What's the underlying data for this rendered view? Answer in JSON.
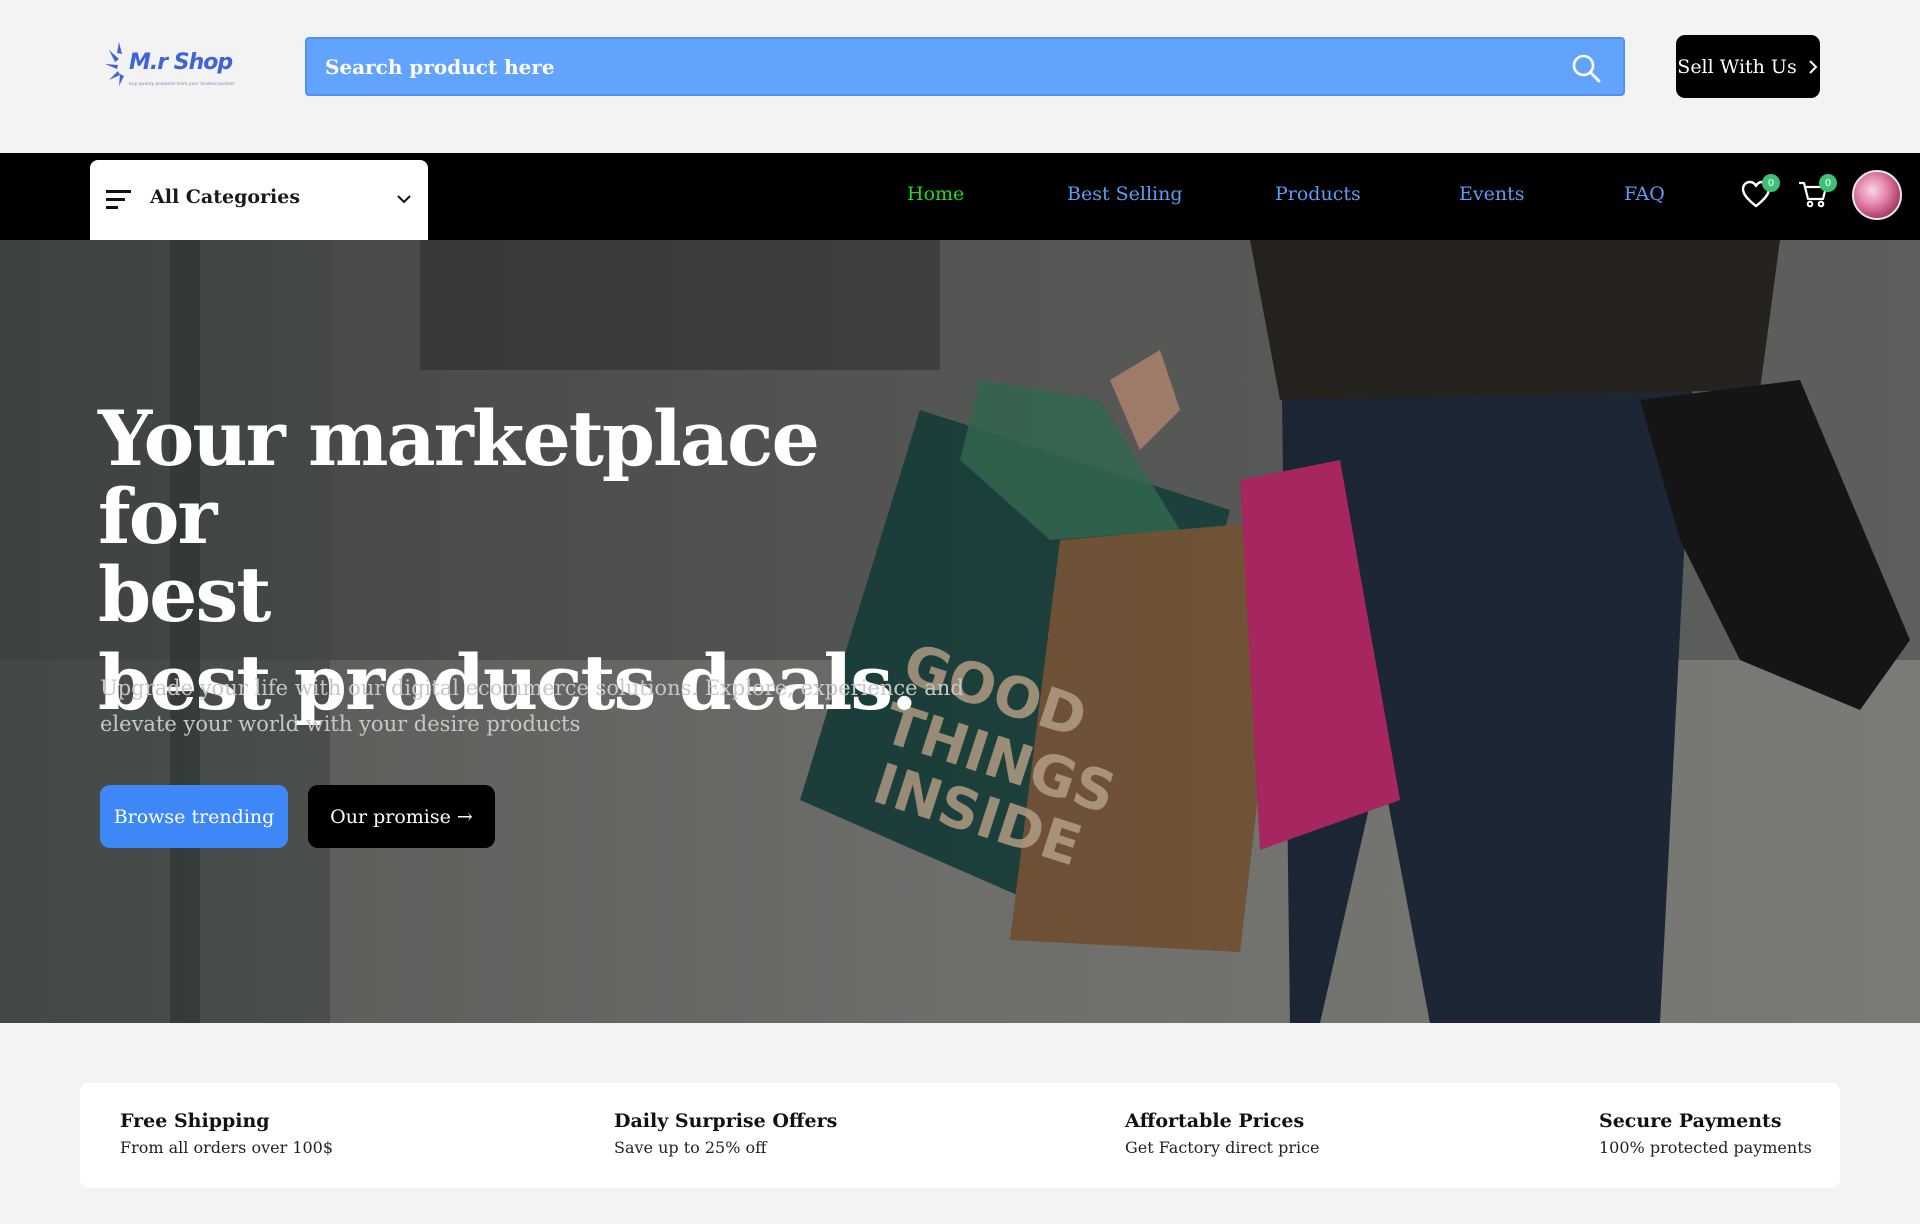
{
  "brand": {
    "name": "M.r Shop",
    "tagline": "buy quality products from your trusted partner",
    "color": "#3f63d8"
  },
  "search": {
    "placeholder": "Search product here",
    "icon": "search-icon"
  },
  "header": {
    "sell_label": "Sell With Us"
  },
  "nav": {
    "categories_label": "All Categories",
    "links": [
      {
        "label": "Home",
        "active": true
      },
      {
        "label": "Best Selling",
        "active": false
      },
      {
        "label": "Products",
        "active": false
      },
      {
        "label": "Events",
        "active": false
      },
      {
        "label": "FAQ",
        "active": false
      }
    ],
    "wishlist_count": "0",
    "cart_count": "0",
    "active_color": "#17dd1f",
    "link_color": "#5b9df5",
    "badge_color": "#3cc177"
  },
  "hero": {
    "title_line1": "Your marketplace for",
    "title_line2": "best",
    "title_line3": "best products deals.",
    "subtitle": "Upgrade your life with our digital ecommerce solutions. Explore, experience and elevate your world with your desire products",
    "primary_button": "Browse trending",
    "secondary_button": "Our promise →",
    "primary_color": "#3d87f6"
  },
  "features": [
    {
      "title": "Free Shipping",
      "desc": "From all orders over 100$"
    },
    {
      "title": "Daily Surprise Offers",
      "desc": "Save up to 25% off"
    },
    {
      "title": "Affortable Prices",
      "desc": "Get Factory direct price"
    },
    {
      "title": "Secure Payments",
      "desc": "100% protected payments"
    }
  ]
}
